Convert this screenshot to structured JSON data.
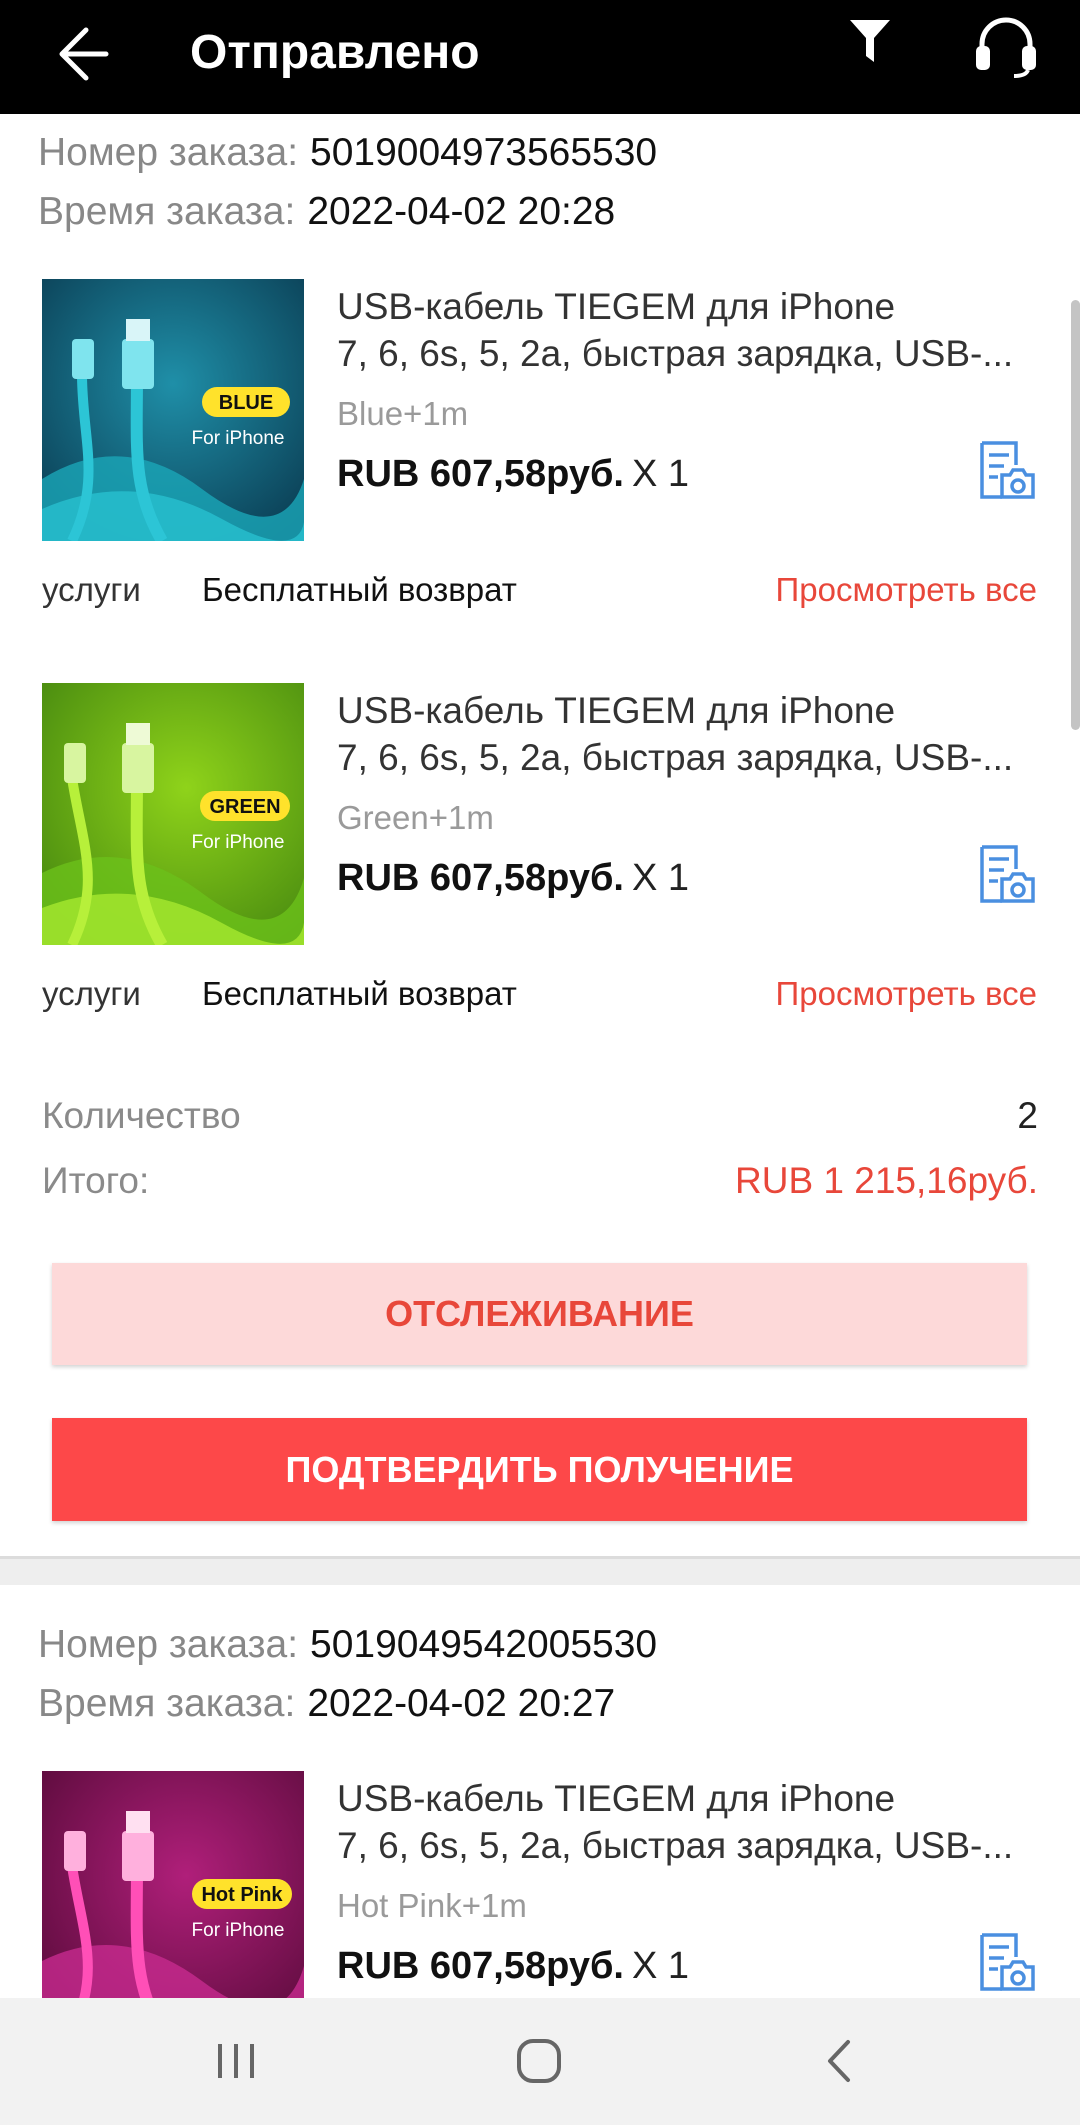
{
  "header": {
    "title": "Отправлено",
    "back_icon": "arrow-left-icon",
    "filter_icon": "filter-icon",
    "support_icon": "headset-icon"
  },
  "orders": [
    {
      "number_label": "Номер заказа:",
      "number": "5019004973565530",
      "time_label": "Время заказа:",
      "time": "2022-04-02 20:28",
      "items": [
        {
          "title_line1": "USB-кабель TIEGEM для iPhone",
          "title_line2": "7, 6, 6s, 5, 2a, быстрая зарядка, USB-...",
          "variant": "Blue+1m",
          "price": "RUB 607,58руб.",
          "qty": "X 1",
          "badge": "BLUE",
          "badge_sub": "For iPhone",
          "service_label": "услуги",
          "service_value": "Бесплатный возврат",
          "view_all": "Просмотреть все"
        },
        {
          "title_line1": "USB-кабель TIEGEM для iPhone",
          "title_line2": "7, 6, 6s, 5, 2a, быстрая зарядка, USB-...",
          "variant": "Green+1m",
          "price": "RUB 607,58руб.",
          "qty": "X 1",
          "badge": "GREEN",
          "badge_sub": "For iPhone",
          "service_label": "услуги",
          "service_value": "Бесплатный возврат",
          "view_all": "Просмотреть все"
        }
      ],
      "quantity_label": "Количество",
      "quantity": "2",
      "total_label": "Итого:",
      "total": "RUB 1 215,16руб.",
      "track_button": "ОТСЛЕЖИВАНИЕ",
      "confirm_button": "ПОДТВЕРДИТЬ ПОЛУЧЕНИЕ"
    },
    {
      "number_label": "Номер заказа:",
      "number": "5019049542005530",
      "time_label": "Время заказа:",
      "time": "2022-04-02 20:27",
      "items": [
        {
          "title_line1": "USB-кабель TIEGEM для iPhone",
          "title_line2": "7, 6, 6s, 5, 2a, быстрая зарядка, USB-...",
          "variant": "Hot Pink+1m",
          "price": "RUB 607,58руб.",
          "qty": "X 1",
          "badge": "Hot Pink",
          "badge_sub": "For iPhone"
        }
      ]
    }
  ],
  "colors": {
    "accent": "#e8473a",
    "confirm_bg": "#fd4849",
    "track_bg": "#fdd9d9",
    "icon_blue": "#4a8fe0"
  },
  "navbar": {
    "recent_icon": "recent-apps-icon",
    "home_icon": "home-icon",
    "back_icon": "nav-back-icon"
  }
}
